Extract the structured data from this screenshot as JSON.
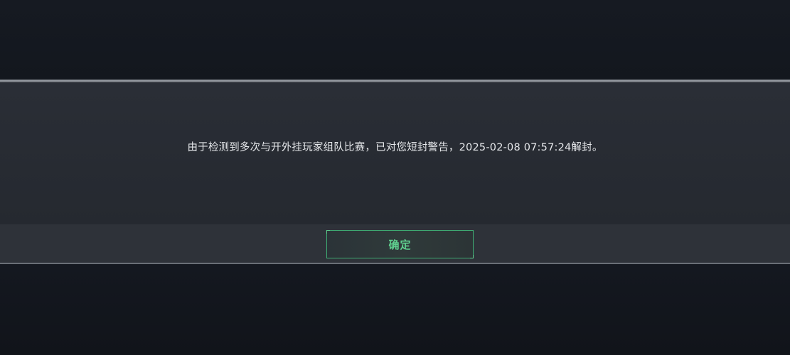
{
  "dialog": {
    "message": "由于检测到多次与开外挂玩家组队比赛，已对您短封警告，2025-02-08 07:57:24解封。",
    "confirm_label": "确定"
  },
  "colors": {
    "accent": "#5fd08f",
    "button_border": "#3fae74",
    "dialog_bg": "#242830",
    "text": "#e6e8eb"
  }
}
